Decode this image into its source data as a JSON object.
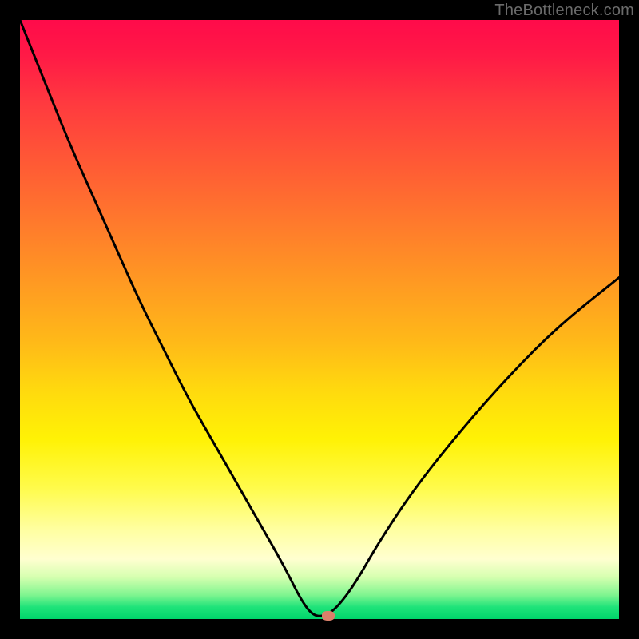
{
  "watermark": "TheBottleneck.com",
  "colors": {
    "frame": "#000000",
    "gradient_top": "#ff0b4a",
    "gradient_mid1": "#ff9a22",
    "gradient_mid2": "#fff205",
    "gradient_bottom": "#00d56b",
    "curve": "#000000",
    "marker": "#d9806a",
    "watermark_text": "#6b6b6b"
  },
  "chart_data": {
    "type": "line",
    "title": "",
    "xlabel": "",
    "ylabel": "",
    "xlim": [
      0,
      100
    ],
    "ylim": [
      0,
      100
    ],
    "series": [
      {
        "name": "bottleneck-curve",
        "x": [
          0,
          4,
          8,
          12,
          16,
          20,
          24,
          28,
          32,
          36,
          40,
          44,
          47,
          49,
          51,
          53,
          56,
          60,
          66,
          74,
          82,
          90,
          100
        ],
        "y": [
          100,
          90,
          80,
          71,
          62,
          53,
          45,
          37,
          30,
          23,
          16,
          9,
          3,
          0.5,
          0.5,
          2,
          6,
          13,
          22,
          32,
          41,
          49,
          57
        ]
      }
    ],
    "marker": {
      "x": 51.5,
      "y": 0.6
    },
    "background_gradient": {
      "orientation": "vertical",
      "stops": [
        {
          "pos": 0.0,
          "color": "#ff0b4a"
        },
        {
          "pos": 0.34,
          "color": "#ff7a2c"
        },
        {
          "pos": 0.62,
          "color": "#ffda0e"
        },
        {
          "pos": 0.85,
          "color": "#ffffa0"
        },
        {
          "pos": 1.0,
          "color": "#00d56b"
        }
      ]
    }
  }
}
